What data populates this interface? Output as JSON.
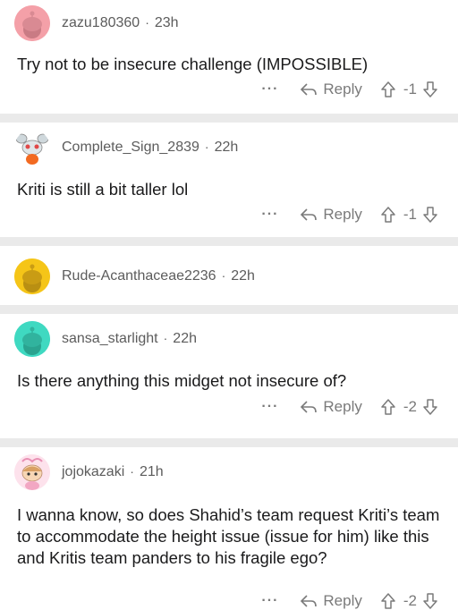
{
  "comments": [
    {
      "username": "zazu180360",
      "time": "23h",
      "text": "Try not to be insecure challenge (IMPOSSIBLE)",
      "reply_label": "Reply",
      "score": "-1",
      "avatar_color": "#f4a0a8"
    },
    {
      "username": "Complete_Sign_2839",
      "time": "22h",
      "text": "Kriti is still a bit taller lol",
      "reply_label": "Reply",
      "score": "-1",
      "avatar_color": "#ffffff"
    },
    {
      "username": "Rude-Acanthaceae2236",
      "time": "22h",
      "avatar_color": "#f5c518"
    },
    {
      "username": "sansa_starlight",
      "time": "22h",
      "text": "Is there anything this midget not insecure of?",
      "reply_label": "Reply",
      "score": "-2",
      "avatar_color": "#3fd9c1"
    },
    {
      "username": "jojokazaki",
      "time": "21h",
      "text": "I wanna know, so does Shahid’s team request Kriti’s team to accommodate the height issue (issue for him) like this and Kritis team panders to his fragile ego?",
      "reply_label": "Reply",
      "score": "-2",
      "avatar_color": "#fde2ec"
    }
  ],
  "more_glyph": "···",
  "separator": "·"
}
